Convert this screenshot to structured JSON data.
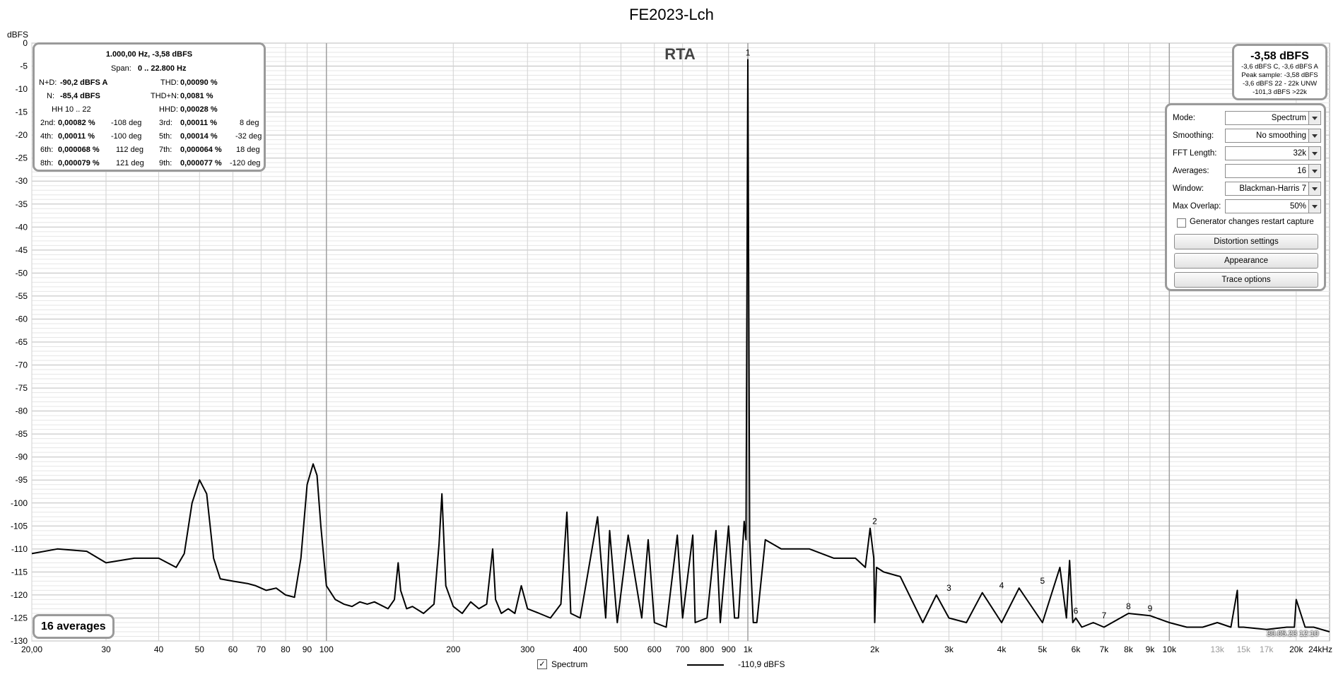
{
  "window": {
    "title": "FE2023-Lch"
  },
  "chart_data": {
    "type": "line",
    "title": "FE2023-Lch",
    "watermark": "RTA",
    "ylabel": "dBFS",
    "xlabel": "",
    "xscale": "log",
    "xlim": [
      20,
      24000
    ],
    "ylim": [
      -130,
      0
    ],
    "grid": true,
    "y_ticks": [
      "0",
      "-5",
      "-10",
      "-15",
      "-20",
      "-25",
      "-30",
      "-35",
      "-40",
      "-45",
      "-50",
      "-55",
      "-60",
      "-65",
      "-70",
      "-75",
      "-80",
      "-85",
      "-90",
      "-95",
      "-100",
      "-105",
      "-110",
      "-115",
      "-120",
      "-125",
      "-130"
    ],
    "x_ticks": [
      {
        "v": 20,
        "label": "20,00"
      },
      {
        "v": 30,
        "label": "30"
      },
      {
        "v": 40,
        "label": "40"
      },
      {
        "v": 50,
        "label": "50"
      },
      {
        "v": 60,
        "label": "60"
      },
      {
        "v": 70,
        "label": "70"
      },
      {
        "v": 80,
        "label": "80"
      },
      {
        "v": 90,
        "label": "90"
      },
      {
        "v": 100,
        "label": "100"
      },
      {
        "v": 200,
        "label": "200"
      },
      {
        "v": 300,
        "label": "300"
      },
      {
        "v": 400,
        "label": "400"
      },
      {
        "v": 500,
        "label": "500"
      },
      {
        "v": 600,
        "label": "600"
      },
      {
        "v": 700,
        "label": "700"
      },
      {
        "v": 800,
        "label": "800"
      },
      {
        "v": 900,
        "label": "900"
      },
      {
        "v": 1000,
        "label": "1k"
      },
      {
        "v": 2000,
        "label": "2k"
      },
      {
        "v": 3000,
        "label": "3k"
      },
      {
        "v": 4000,
        "label": "4k"
      },
      {
        "v": 5000,
        "label": "5k"
      },
      {
        "v": 6000,
        "label": "6k"
      },
      {
        "v": 7000,
        "label": "7k"
      },
      {
        "v": 8000,
        "label": "8k"
      },
      {
        "v": 9000,
        "label": "9k"
      },
      {
        "v": 10000,
        "label": "10k"
      },
      {
        "v": 13000,
        "label": "13k"
      },
      {
        "v": 15000,
        "label": "15k"
      },
      {
        "v": 17000,
        "label": "17k"
      },
      {
        "v": 20000,
        "label": "20k"
      },
      {
        "v": 24000,
        "label": "24kHz"
      }
    ],
    "harmonic_markers": [
      {
        "label": "1",
        "x": 1000,
        "y": -3.6
      },
      {
        "label": "2",
        "x": 2000,
        "y": -105.5
      },
      {
        "label": "3",
        "x": 3000,
        "y": -120
      },
      {
        "label": "4",
        "x": 4000,
        "y": -119.5
      },
      {
        "label": "5",
        "x": 5000,
        "y": -118.5
      },
      {
        "label": "6",
        "x": 6000,
        "y": -125
      },
      {
        "label": "7",
        "x": 7000,
        "y": -126
      },
      {
        "label": "8",
        "x": 8000,
        "y": -124
      },
      {
        "label": "9",
        "x": 9000,
        "y": -124.5
      }
    ],
    "series": [
      {
        "name": "Spectrum",
        "color": "#000000",
        "x": [
          20,
          23,
          27,
          30,
          35,
          40,
          44,
          46,
          48,
          50,
          52,
          54,
          56,
          60,
          65,
          68,
          72,
          76,
          80,
          84,
          87,
          90,
          93,
          95,
          97,
          100,
          105,
          110,
          115,
          120,
          125,
          130,
          140,
          145,
          148,
          150,
          155,
          160,
          170,
          180,
          185,
          188,
          192,
          200,
          210,
          220,
          230,
          240,
          248,
          252,
          260,
          270,
          280,
          290,
          300,
          320,
          340,
          360,
          372,
          380,
          400,
          440,
          460,
          470,
          490,
          520,
          560,
          580,
          600,
          640,
          680,
          700,
          740,
          750,
          800,
          840,
          860,
          900,
          930,
          950,
          980,
          990,
          1000,
          1010,
          1030,
          1050,
          1100,
          1200,
          1400,
          1600,
          1800,
          1900,
          1950,
          1990,
          2000,
          2020,
          2100,
          2300,
          2600,
          2800,
          3000,
          3300,
          3600,
          4000,
          4400,
          5000,
          5500,
          5700,
          5800,
          5900,
          6000,
          6200,
          6600,
          7000,
          8000,
          9000,
          10000,
          11000,
          12000,
          13000,
          14000,
          14500,
          14600,
          15000,
          17000,
          19000,
          19800,
          20000,
          21000,
          22000,
          24000
        ],
        "y": [
          -111,
          -110,
          -110.5,
          -113,
          -112,
          -112,
          -114,
          -111,
          -100,
          -95,
          -98,
          -112,
          -116.5,
          -117,
          -117.5,
          -118,
          -119,
          -118.5,
          -120,
          -120.5,
          -112,
          -96,
          -91.5,
          -94,
          -105,
          -118,
          -121,
          -122,
          -122.5,
          -121.5,
          -122,
          -121.5,
          -123,
          -121,
          -113,
          -119,
          -123,
          -122.5,
          -124,
          -122,
          -109,
          -98,
          -118,
          -122.5,
          -124,
          -121.5,
          -123,
          -122,
          -110,
          -121,
          -124,
          -123,
          -124,
          -118,
          -123,
          -124,
          -125,
          -122,
          -102,
          -124,
          -125,
          -103,
          -125,
          -106,
          -126,
          -107,
          -125,
          -108,
          -126,
          -127,
          -107,
          -125,
          -107,
          -126,
          -125,
          -106,
          -126,
          -105,
          -125,
          -125,
          -104,
          -108,
          -3.6,
          -108,
          -126,
          -126,
          -108,
          -110,
          -110,
          -112,
          -112,
          -114,
          -105.5,
          -112,
          -126,
          -114,
          -115,
          -116,
          -126,
          -120,
          -125,
          -126,
          -119.5,
          -126,
          -118.5,
          -126,
          -114,
          -125,
          -112.5,
          -126,
          -125,
          -127,
          -126,
          -127,
          -124,
          -124.5,
          -126,
          -127,
          -127,
          -126,
          -127,
          -119,
          -127,
          -127,
          -127.5,
          -127,
          -127,
          -121,
          -127,
          -127,
          -128
        ]
      }
    ]
  },
  "stats": {
    "header": "1.000,00 Hz, -3,58 dBFS",
    "span_label": "Span:",
    "span_value": "0 .. 22.800 Hz",
    "nd_label": "N+D:",
    "nd_value": "-90,2 dBFS A",
    "thd_label": "THD:",
    "thd_value": "0,00090 %",
    "n_label": "N:",
    "n_value": "-85,4 dBFS",
    "thdn_label": "THD+N:",
    "thdn_value": "0,0081 %",
    "hh_label": "HH 10 .. 22",
    "hhd_label": "HHD:",
    "hhd_value": "0,00028 %",
    "harmonics": [
      {
        "l1": "2nd:",
        "v1": "0,00082 %",
        "d1": "-108 deg",
        "l2": "3rd:",
        "v2": "0,00011 %",
        "d2": "8 deg"
      },
      {
        "l1": "4th:",
        "v1": "0,00011 %",
        "d1": "-100 deg",
        "l2": "5th:",
        "v2": "0,00014 %",
        "d2": "-32 deg"
      },
      {
        "l1": "6th:",
        "v1": "0,000068 %",
        "d1": "112 deg",
        "l2": "7th:",
        "v2": "0,000064 %",
        "d2": "18 deg"
      },
      {
        "l1": "8th:",
        "v1": "0,000079 %",
        "d1": "121 deg",
        "l2": "9th:",
        "v2": "0,000077 %",
        "d2": "-120 deg"
      }
    ]
  },
  "peak_panel": {
    "main": "-3,58 dBFS",
    "line1": "-3,6 dBFS C, -3,6 dBFS A",
    "line2": "Peak sample: -3,58 dBFS",
    "line3": "-3,6 dBFS 22 - 22k UNW",
    "line4": "-101,3 dBFS >22k"
  },
  "settings": {
    "mode_label": "Mode:",
    "mode_value": "Spectrum",
    "smoothing_label": "Smoothing:",
    "smoothing_value": "No  smoothing",
    "fft_label": "FFT Length:",
    "fft_value": "32k",
    "averages_label": "Averages:",
    "averages_value": "16",
    "window_label": "Window:",
    "window_value": "Blackman-Harris 7",
    "overlap_label": "Max Overlap:",
    "overlap_value": "50%",
    "restart_label": "Generator changes restart capture",
    "distortion_button": "Distortion settings",
    "appearance_button": "Appearance",
    "trace_button": "Trace options"
  },
  "averages_badge": "16 averages",
  "legend": {
    "checkbox_mark": "✓",
    "name": "Spectrum",
    "value": "-110,9 dBFS"
  },
  "timestamp": "30.05.23 12:10"
}
